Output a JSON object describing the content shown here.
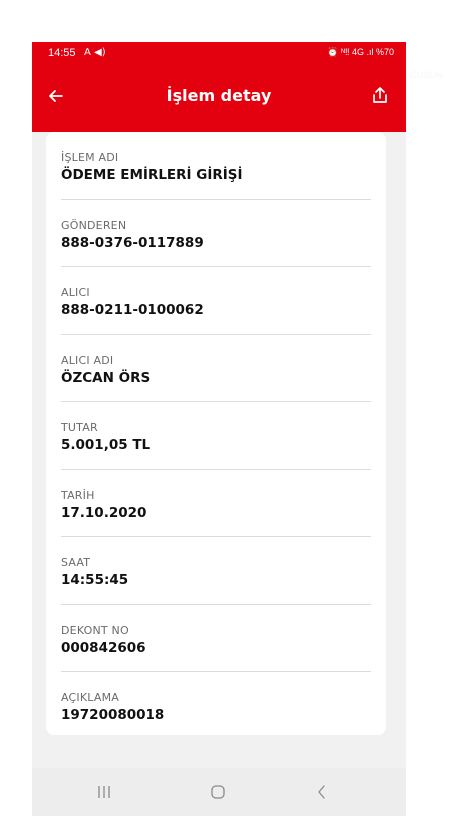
{
  "status_bar": {
    "time": "14:55",
    "left_icons": "A ◀)",
    "right_icons": "⏰ ᴺ‼ 4G .ıl %70"
  },
  "app_bar": {
    "title": "İşlem detay",
    "back_icon": "arrow-left-icon",
    "share_icon": "share-icon"
  },
  "details": [
    {
      "label": "İŞLEM ADI",
      "value": "ÖDEME EMİRLERİ GİRİŞİ"
    },
    {
      "label": "GÖNDEREN",
      "value": "888-0376-0117889"
    },
    {
      "label": "ALICI",
      "value": "888-0211-0100062"
    },
    {
      "label": "ALICI ADI",
      "value": "ÖZCAN ÖRS"
    },
    {
      "label": "TUTAR",
      "value": "5.001,05 TL"
    },
    {
      "label": "TARİH",
      "value": "17.10.2020"
    },
    {
      "label": "SAAT",
      "value": "14:55:45"
    },
    {
      "label": "DEKONT NO",
      "value": "000842606"
    },
    {
      "label": "AÇIKLAMA",
      "value": "19720080018"
    }
  ],
  "nav_bar": {
    "recents_icon": "recents-icon",
    "home_icon": "home-icon",
    "back_icon": "back-chevron-icon"
  },
  "colors": {
    "brand_red": "#e3000f",
    "background": "#f1f1f1",
    "card": "#ffffff"
  }
}
